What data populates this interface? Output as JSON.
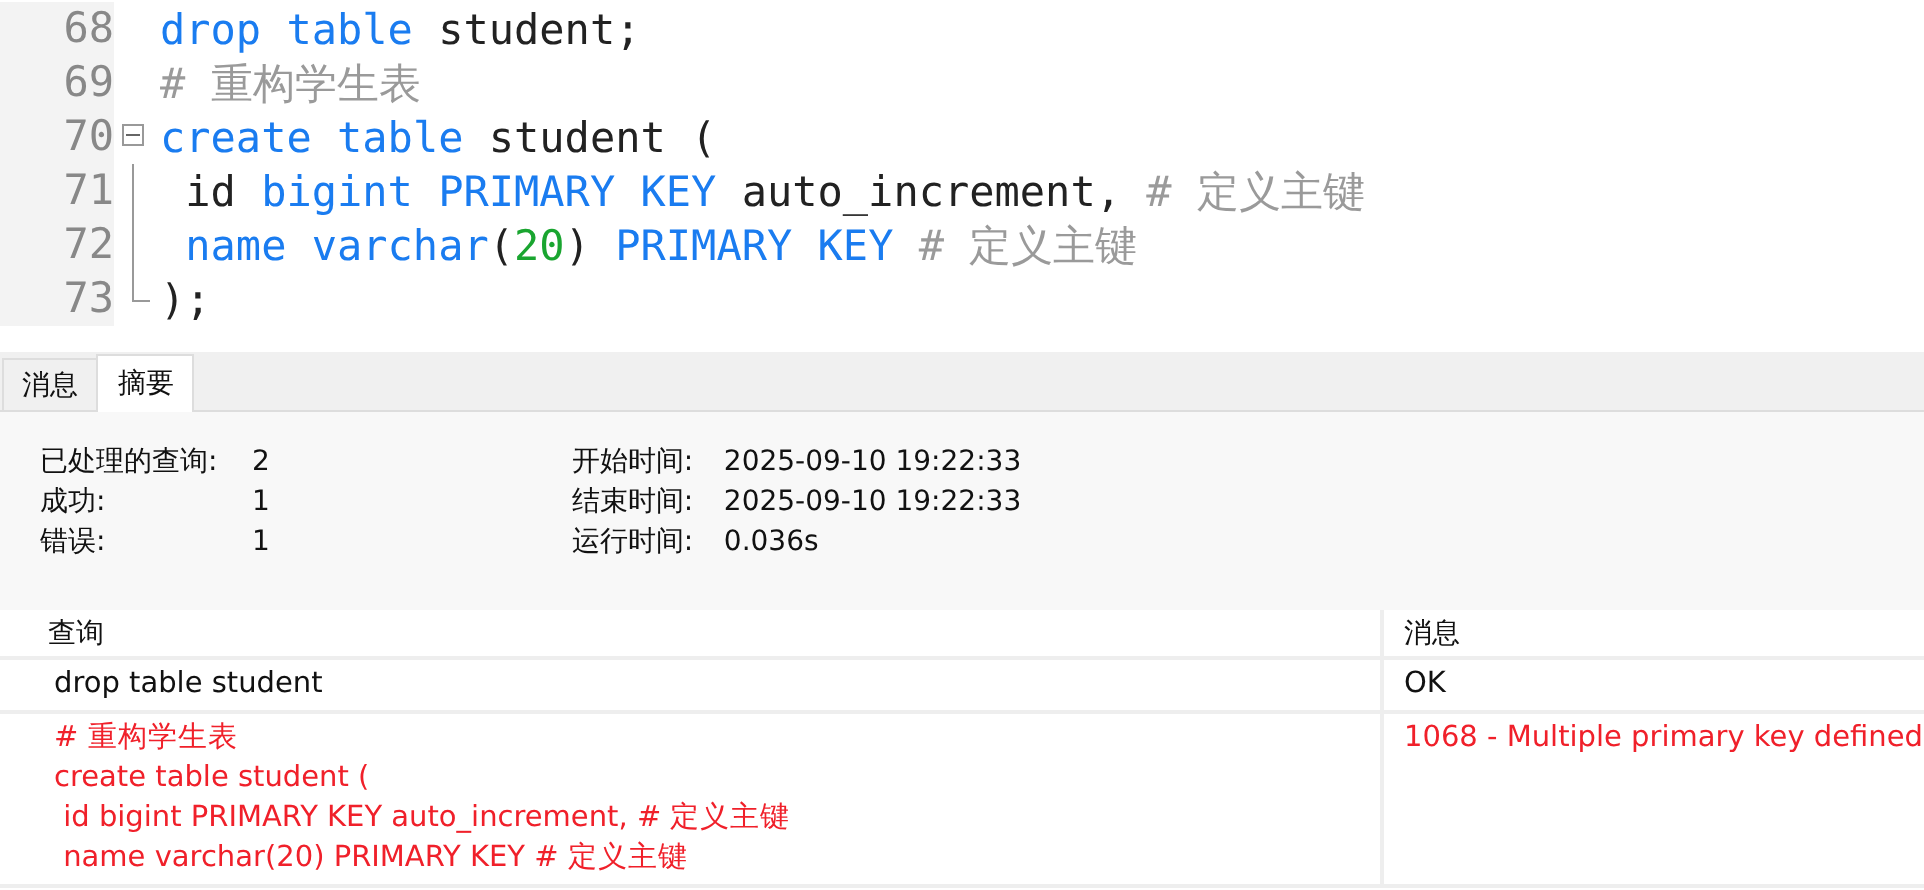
{
  "editor": {
    "lines": [
      {
        "number": "68",
        "tokens": [
          {
            "kind": "keyword",
            "text": "drop "
          },
          {
            "kind": "keyword",
            "text": "table"
          },
          {
            "kind": "plain",
            "text": " student;"
          }
        ]
      },
      {
        "number": "69",
        "tokens": [
          {
            "kind": "comment",
            "text": "# 重构学生表"
          }
        ]
      },
      {
        "number": "70",
        "expanded": true,
        "tokens": [
          {
            "kind": "keyword",
            "text": "create "
          },
          {
            "kind": "keyword",
            "text": "table"
          },
          {
            "kind": "plain",
            "text": " student ("
          }
        ],
        "children": [
          {
            "number": "71",
            "tokens": [
              {
                "kind": "plain",
                "text": " id "
              },
              {
                "kind": "keyword",
                "text": "bigint "
              },
              {
                "kind": "keyword",
                "text": "PRIMARY "
              },
              {
                "kind": "keyword",
                "text": "KEY"
              },
              {
                "kind": "plain",
                "text": " auto_increment, "
              },
              {
                "kind": "comment",
                "text": "# 定义主键"
              }
            ]
          },
          {
            "number": "72",
            "tokens": [
              {
                "kind": "keyword",
                "text": " name "
              },
              {
                "kind": "keyword",
                "text": "varchar"
              },
              {
                "kind": "plain",
                "text": "("
              },
              {
                "kind": "number",
                "text": "20"
              },
              {
                "kind": "plain",
                "text": ") "
              },
              {
                "kind": "keyword",
                "text": "PRIMARY "
              },
              {
                "kind": "keyword",
                "text": "KEY "
              },
              {
                "kind": "comment",
                "text": "# 定义主键"
              }
            ]
          },
          {
            "number": "73",
            "tokens": [
              {
                "kind": "plain",
                "text": ");"
              }
            ]
          }
        ]
      }
    ]
  },
  "tabs": [
    {
      "label": "消息",
      "selected": false
    },
    {
      "label": "摘要",
      "selected": true
    }
  ],
  "summary": {
    "left": [
      {
        "label": "已处理的查询:",
        "value": "2"
      },
      {
        "label": "成功:",
        "value": "1"
      },
      {
        "label": "错误:",
        "value": "1"
      }
    ],
    "right": [
      {
        "label": "开始时间:",
        "value": "2025-09-10 19:22:33"
      },
      {
        "label": "结束时间:",
        "value": "2025-09-10 19:22:33"
      },
      {
        "label": "运行时间:",
        "value": "0.036s"
      }
    ]
  },
  "table": {
    "columns": [
      "查询",
      "消息"
    ],
    "rows": [
      {
        "error": false,
        "query": [
          "drop table student"
        ],
        "message": "OK"
      },
      {
        "error": true,
        "query": [
          "# 重构学生表",
          "create table student (",
          " id bigint PRIMARY KEY auto_increment, # 定义主键",
          " name varchar(20) PRIMARY KEY # 定义主键"
        ],
        "message": "1068 - Multiple primary key defined"
      }
    ]
  }
}
